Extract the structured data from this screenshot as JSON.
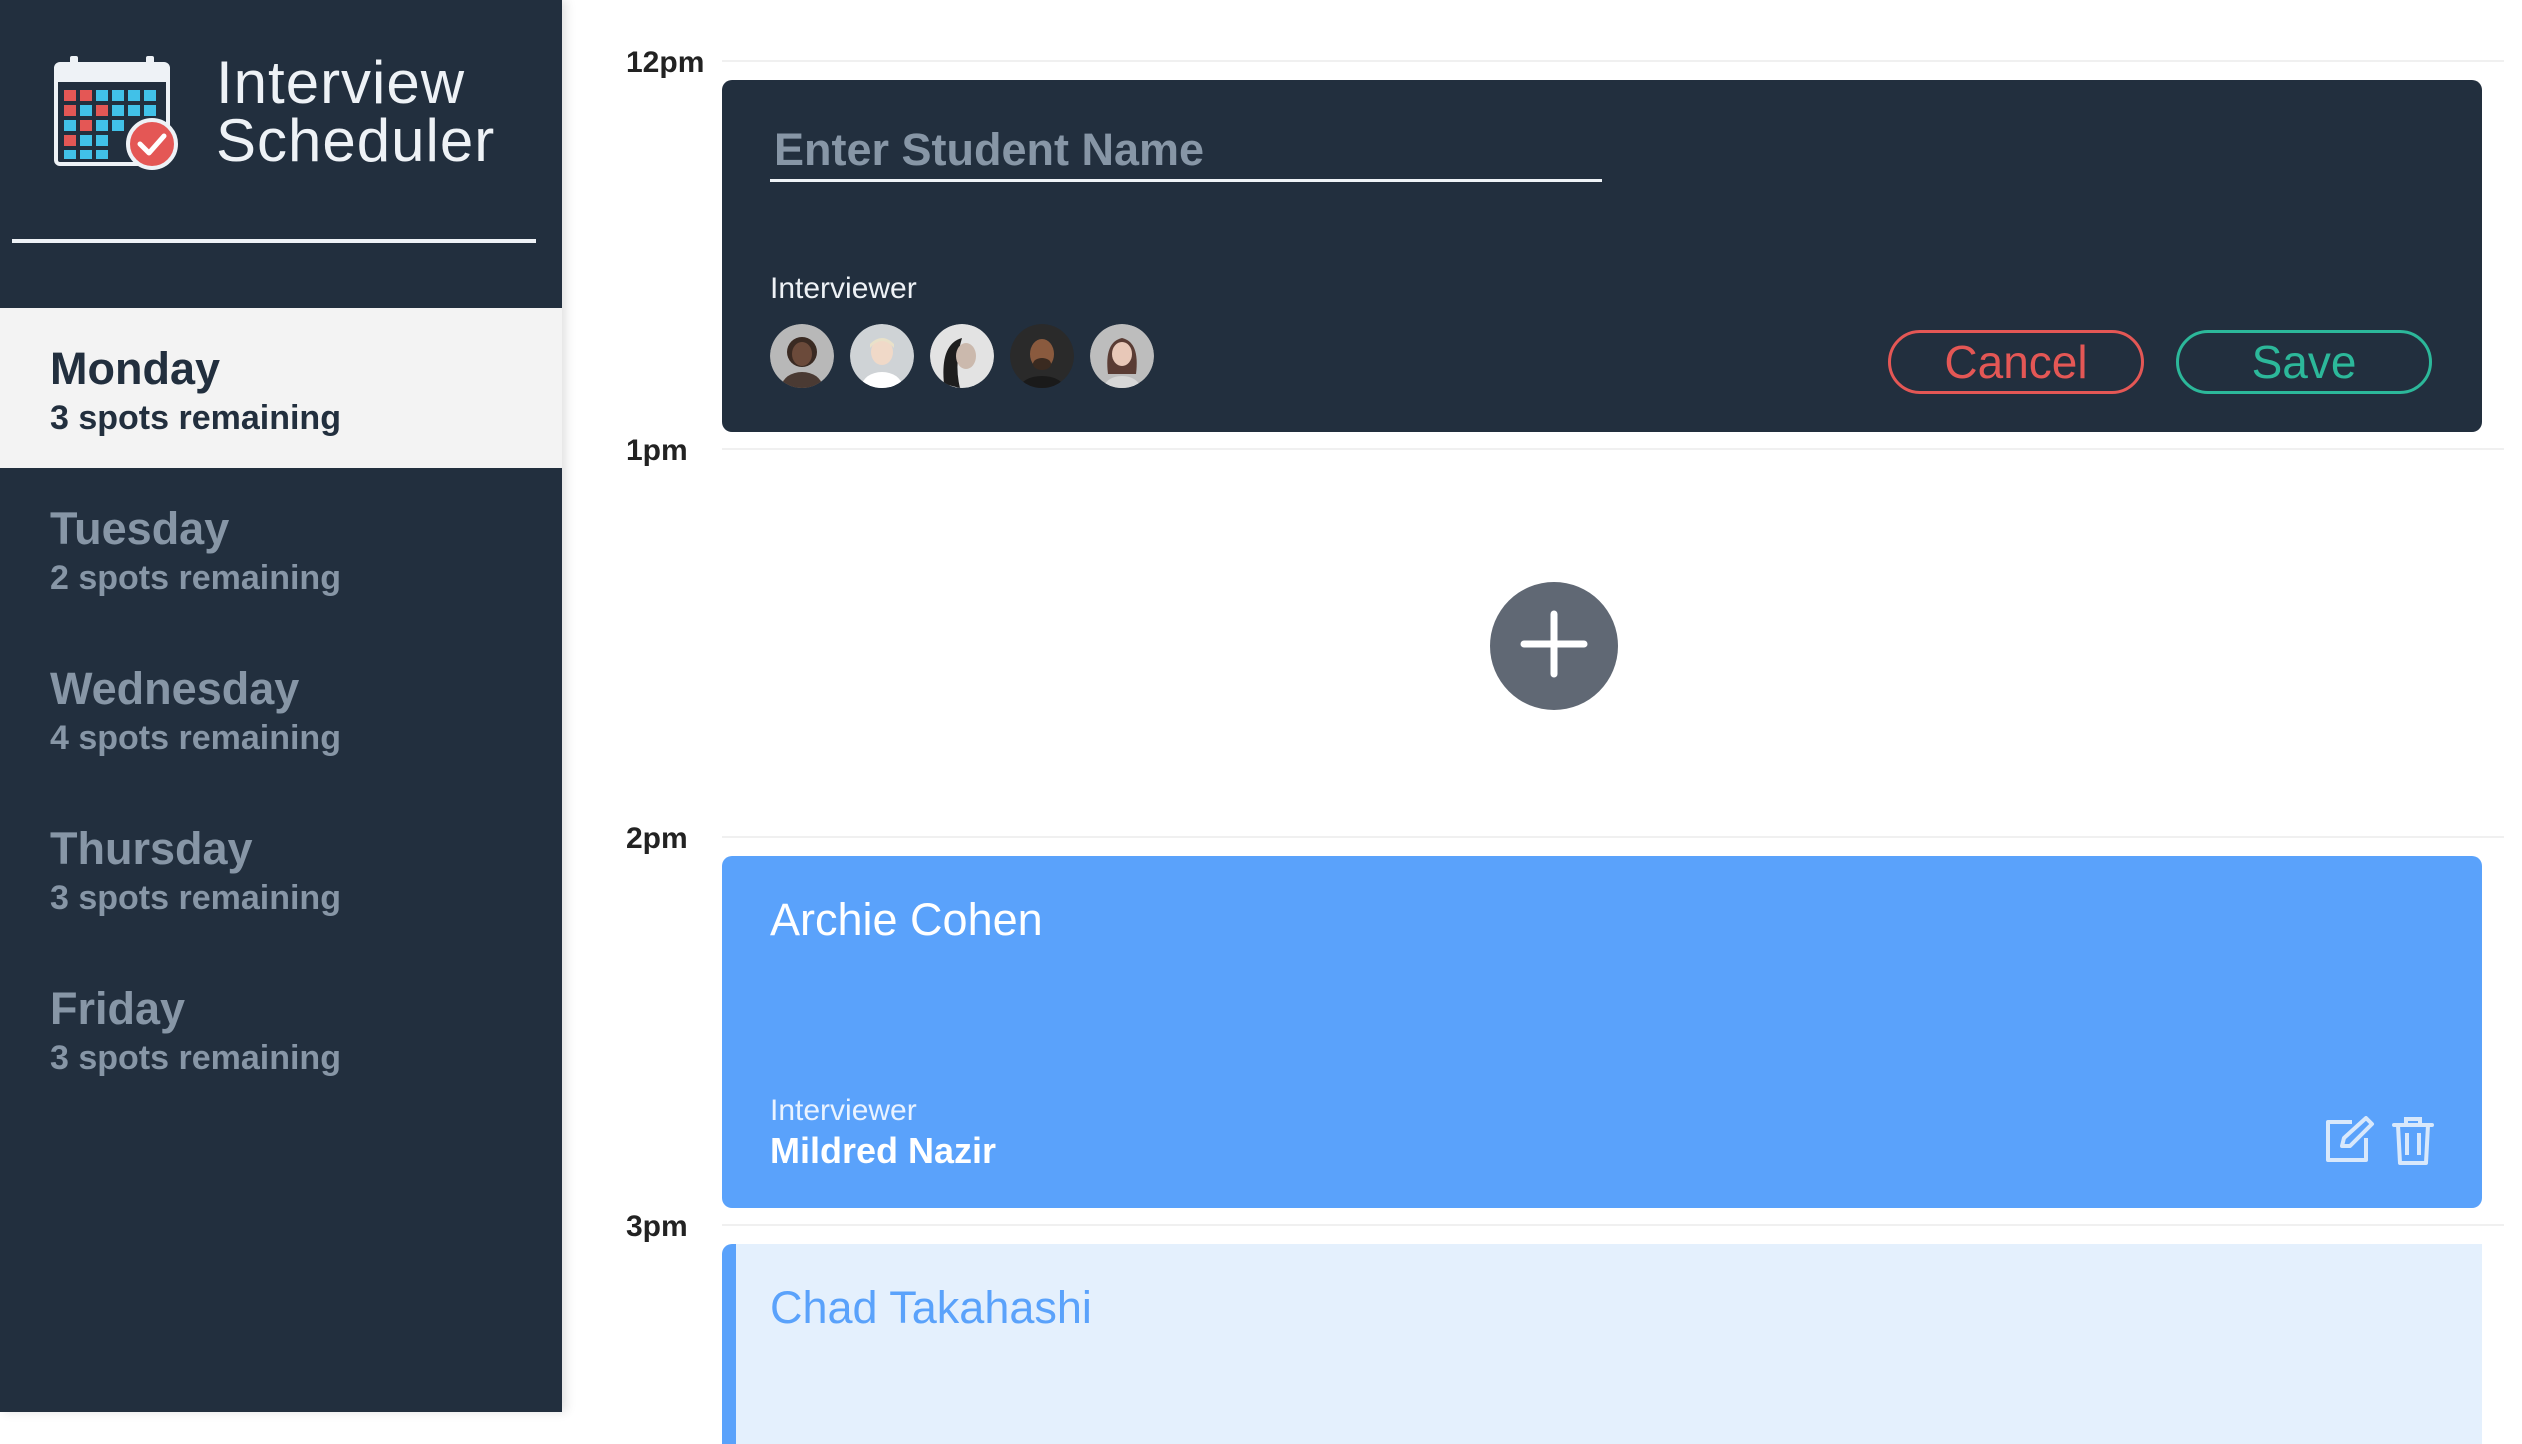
{
  "app": {
    "title_line1": "Interview",
    "title_line2": "Scheduler",
    "logo_icon": "calendar-check-icon"
  },
  "sidebar": {
    "days": [
      {
        "name": "Monday",
        "spots": "3 spots remaining",
        "selected": true
      },
      {
        "name": "Tuesday",
        "spots": "2 spots remaining",
        "selected": false
      },
      {
        "name": "Wednesday",
        "spots": "4 spots remaining",
        "selected": false
      },
      {
        "name": "Thursday",
        "spots": "3 spots remaining",
        "selected": false
      },
      {
        "name": "Friday",
        "spots": "3 spots remaining",
        "selected": false
      }
    ]
  },
  "schedule": {
    "times": [
      "12pm",
      "1pm",
      "2pm",
      "3pm"
    ],
    "form": {
      "name_placeholder": "Enter Student Name",
      "name_value": "",
      "interviewer_label": "Interviewer",
      "cancel_label": "Cancel",
      "save_label": "Save",
      "avatars": [
        "interviewer-avatar-1",
        "interviewer-avatar-2",
        "interviewer-avatar-3",
        "interviewer-avatar-4",
        "interviewer-avatar-5"
      ]
    },
    "add_icon": "plus-icon",
    "appointment": {
      "student": "Archie Cohen",
      "interviewer_label": "Interviewer",
      "interviewer_name": "Mildred Nazir",
      "edit_icon": "edit-icon",
      "delete_icon": "trash-icon"
    },
    "pending": {
      "student": "Chad Takahashi"
    }
  },
  "colors": {
    "sidebar_bg": "#222f3e",
    "selected_day_bg": "#f3f3f3",
    "cancel": "#e45755",
    "save": "#2cb89a",
    "appointment_bg": "#5aa2fb",
    "pending_bg": "#e4f0fd",
    "add_button_bg": "#606874"
  }
}
